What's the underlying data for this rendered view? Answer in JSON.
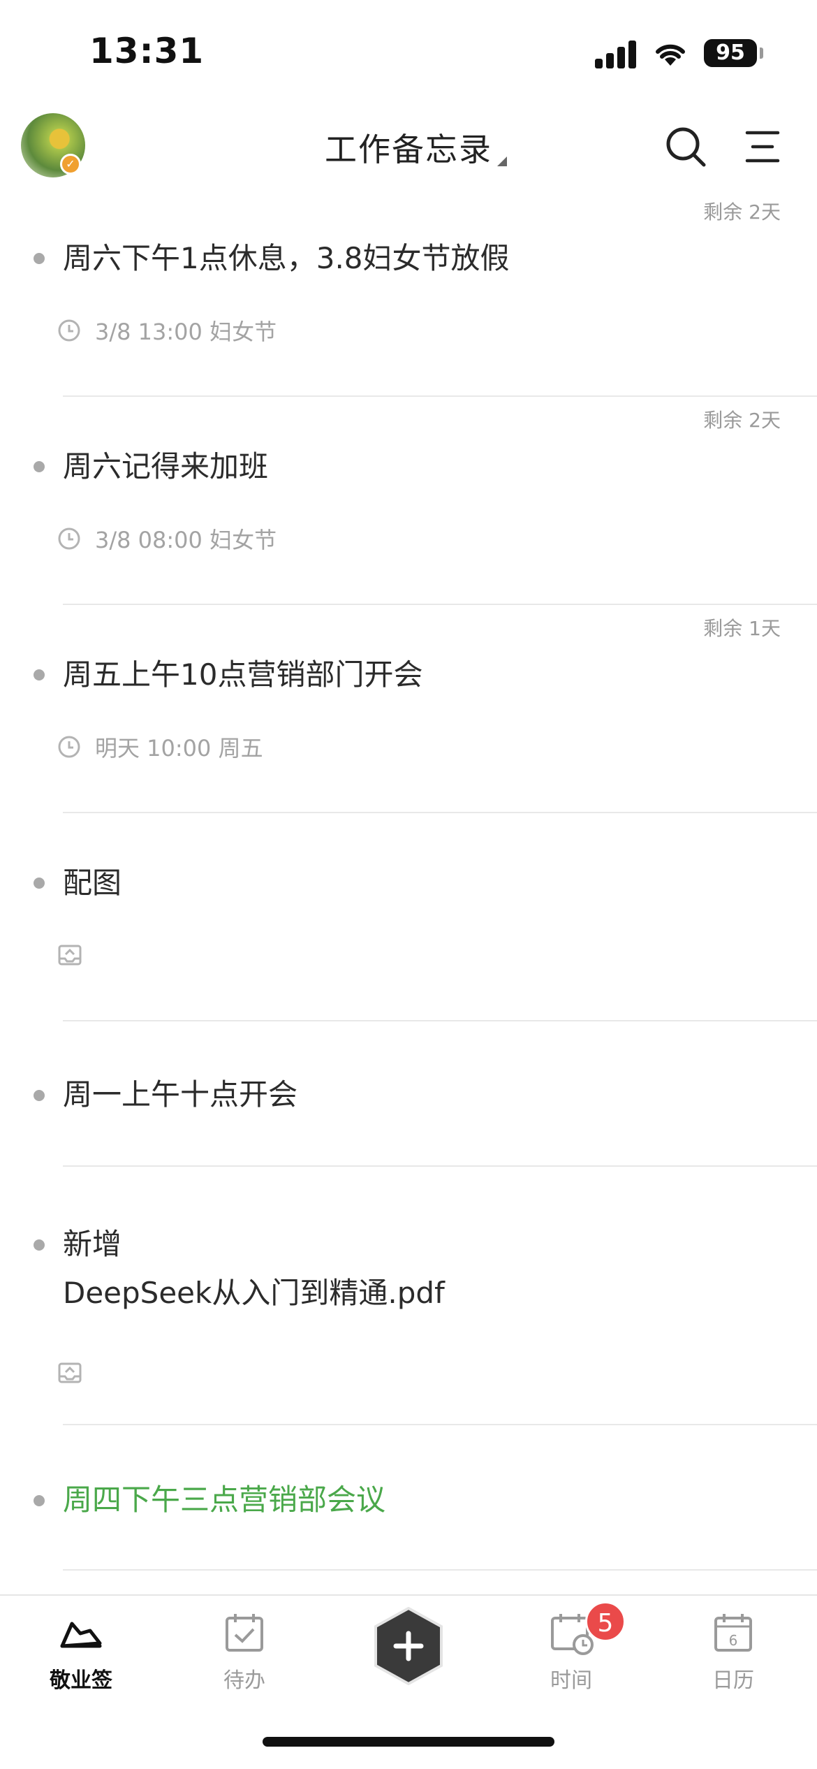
{
  "status_bar": {
    "time": "13:31",
    "battery": "95"
  },
  "header": {
    "title": "工作备忘录"
  },
  "notes": [
    {
      "remaining": "剩余 2天",
      "text": "周六下午1点休息，3.8妇女节放假",
      "meta": "3/8 13:00 妇女节",
      "meta_icon": "clock-icon"
    },
    {
      "remaining": "剩余 2天",
      "text": "周六记得来加班",
      "meta": "3/8 08:00 妇女节",
      "meta_icon": "clock-icon"
    },
    {
      "remaining": "剩余 1天",
      "text": "周五上午10点营销部门开会",
      "meta": "明天 10:00 周五",
      "meta_icon": "clock-icon"
    },
    {
      "text": "配图",
      "meta_icon": "inbox-tray-icon"
    },
    {
      "text": "周一上午十点开会"
    },
    {
      "text_line1": "新增",
      "text_line2": "DeepSeek从入门到精通.pdf",
      "meta_icon": "inbox-tray-icon"
    },
    {
      "text": "周四下午三点营销部会议",
      "color": "#4aa84a"
    }
  ],
  "tabbar": {
    "tabs": [
      {
        "label": "敬业签",
        "icon": "app-logo-icon",
        "active": true
      },
      {
        "label": "待办",
        "icon": "calendar-check-icon",
        "active": false
      },
      {
        "label": "时间",
        "icon": "calendar-clock-icon",
        "active": false,
        "badge": "5"
      },
      {
        "label": "日历",
        "icon": "calendar-date-icon",
        "active": false,
        "date": "6"
      }
    ],
    "add_icon": "plus-icon"
  },
  "colors": {
    "accent_green": "#4aa84a",
    "badge_red": "#ea4a4a",
    "text_gray": "#9a9a9a"
  }
}
